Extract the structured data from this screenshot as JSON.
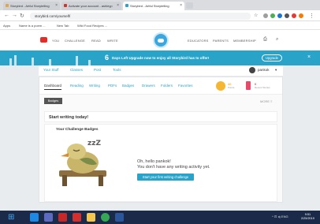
{
  "browser": {
    "tabs": [
      {
        "label": "Storybird - Artful Storytelling",
        "favicon_color": "#e8a33c"
      },
      {
        "label": "Activate your account - ashleyp",
        "favicon_color": "#d93025"
      },
      {
        "label": "Storybird - Artful Storytelling",
        "favicon_color": "#2aa3c8"
      }
    ],
    "url": "storybird.com/yourself/",
    "bookmarks": [
      "Apps",
      "Name is a poem ...",
      "New Tab",
      "Wild Food Recipes ..."
    ]
  },
  "site_nav": {
    "left_links": [
      "YOU",
      "CHALLENGE",
      "READ",
      "WRITE"
    ],
    "right_links": [
      "EDUCATORS",
      "PARENTS",
      "MEMBERSHIP"
    ]
  },
  "banner": {
    "days_number": "6",
    "days_label": "Days Left",
    "message": "Upgrade now to enjoy all Storybird has to offer!",
    "upgrade_label": "Upgrade",
    "close": "×"
  },
  "subnav": {
    "items": [
      "Your Stuff",
      "Classes",
      "Post",
      "Tools"
    ],
    "username": "pankok"
  },
  "dashboard": {
    "tabs": [
      "Dashboard",
      "Reading",
      "Writing",
      "PDFs",
      "Badges",
      "Drawers",
      "Folders",
      "Favorites"
    ],
    "stats": [
      {
        "value": "40",
        "label": "Points",
        "color": "#f5b731"
      },
      {
        "value": "0",
        "label": "Recent Stories",
        "color": "#e94a6a"
      }
    ],
    "badges_label": "Badges",
    "more_label": "MORE ≡",
    "start_heading": "Start writing today!",
    "challenge_heading": "Your Challenge Badges",
    "greeting": "Oh, hello pankok!",
    "no_activity": "You don't have any writing activity yet.",
    "cta_label": "Start your first writing challenge",
    "zzz": "zzZ"
  },
  "taskbar": {
    "tray_text": "^ ⊡ ◂) ENG",
    "time": "9:51",
    "date": "2/25/2019",
    "apps": [
      {
        "name": "ie",
        "color": "#1e88e5"
      },
      {
        "name": "store",
        "color": "#5c6bc0"
      },
      {
        "name": "acrobat",
        "color": "#c62828"
      },
      {
        "name": "acrobat2",
        "color": "#d32f2f"
      },
      {
        "name": "explorer",
        "color": "#f4c64f"
      },
      {
        "name": "chrome",
        "color": "#34a853"
      },
      {
        "name": "word",
        "color": "#2b579a"
      }
    ]
  }
}
